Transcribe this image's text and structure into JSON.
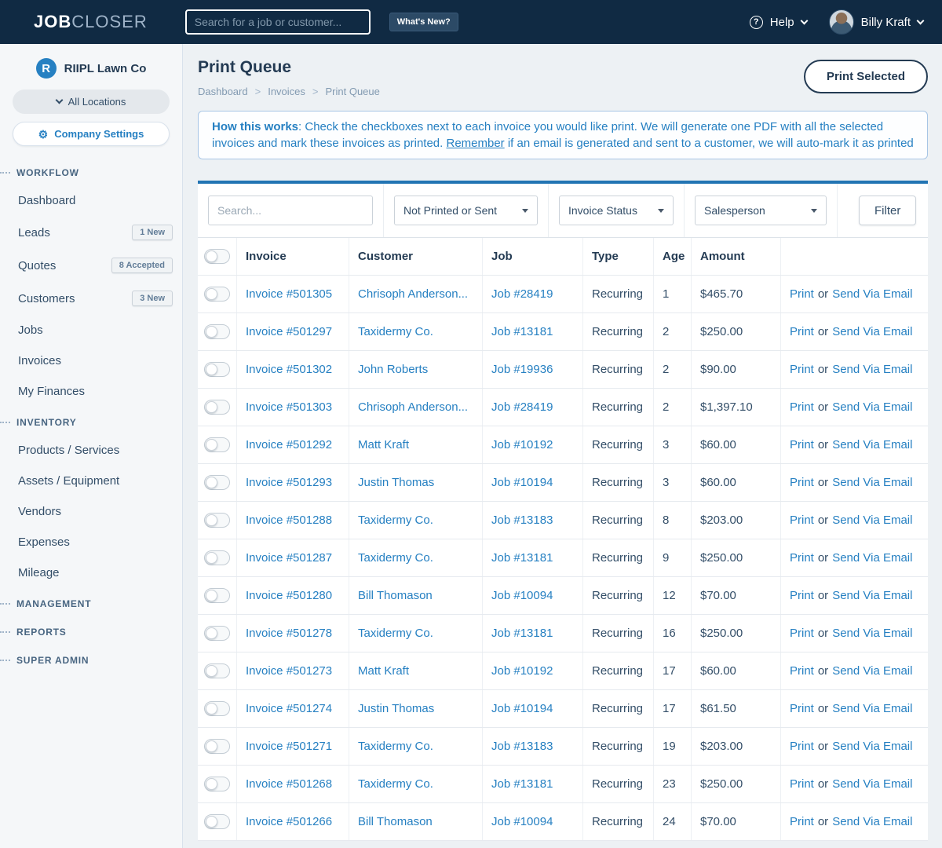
{
  "topbar": {
    "logo_bold": "JOB",
    "logo_light": "CLOSER",
    "search_placeholder": "Search for a job or customer...",
    "whats_new": "What's New?",
    "help": "Help",
    "user_name": "Billy Kraft"
  },
  "sidebar": {
    "company_initial": "R",
    "company_name": "RIIPL Lawn Co",
    "locations_label": "All Locations",
    "settings_label": "Company Settings",
    "sections": [
      {
        "label": "WORKFLOW",
        "items": [
          {
            "label": "Dashboard"
          },
          {
            "label": "Leads",
            "badge": "1 New"
          },
          {
            "label": "Quotes",
            "badge": "8 Accepted"
          },
          {
            "label": "Customers",
            "badge": "3 New"
          },
          {
            "label": "Jobs"
          },
          {
            "label": "Invoices"
          },
          {
            "label": "My Finances"
          }
        ]
      },
      {
        "label": "INVENTORY",
        "items": [
          {
            "label": "Products / Services"
          },
          {
            "label": "Assets / Equipment"
          },
          {
            "label": "Vendors"
          },
          {
            "label": "Expenses"
          },
          {
            "label": "Mileage"
          }
        ]
      },
      {
        "label": "MANAGEMENT",
        "items": []
      },
      {
        "label": "REPORTS",
        "items": []
      },
      {
        "label": "SUPER ADMIN",
        "items": []
      }
    ]
  },
  "main": {
    "title": "Print Queue",
    "breadcrumb": [
      "Dashboard",
      "Invoices",
      "Print Queue"
    ],
    "breadcrumb_separator": ">",
    "print_selected_label": "Print Selected",
    "info": {
      "lead": "How this works",
      "text1": ": Check the checkboxes next to each invoice you would like print. We will generate one PDF with all the selected invoices and mark these invoices as printed. ",
      "remember": "Remember",
      "text2": " if an email is generated and sent to a customer, we will auto-mark it as printed"
    },
    "filters": {
      "search_placeholder": "Search...",
      "printed_filter": "Not Printed or Sent",
      "status_filter": "Invoice Status",
      "salesperson_filter": "Salesperson",
      "filter_button": "Filter"
    },
    "table": {
      "headers": {
        "invoice": "Invoice",
        "customer": "Customer",
        "job": "Job",
        "type": "Type",
        "age": "Age",
        "amount": "Amount"
      },
      "action_print": "Print",
      "action_or": "or",
      "action_email": "Send Via Email",
      "rows": [
        {
          "invoice": "Invoice #501305",
          "customer": "Chrisoph Anderson...",
          "job": "Job #28419",
          "type": "Recurring",
          "age": "1",
          "amount": "$465.70"
        },
        {
          "invoice": "Invoice #501297",
          "customer": "Taxidermy Co.",
          "job": "Job #13181",
          "type": "Recurring",
          "age": "2",
          "amount": "$250.00"
        },
        {
          "invoice": "Invoice #501302",
          "customer": "John Roberts",
          "job": "Job #19936",
          "type": "Recurring",
          "age": "2",
          "amount": "$90.00"
        },
        {
          "invoice": "Invoice #501303",
          "customer": "Chrisoph Anderson...",
          "job": "Job #28419",
          "type": "Recurring",
          "age": "2",
          "amount": "$1,397.10"
        },
        {
          "invoice": "Invoice #501292",
          "customer": "Matt Kraft",
          "job": "Job #10192",
          "type": "Recurring",
          "age": "3",
          "amount": "$60.00"
        },
        {
          "invoice": "Invoice #501293",
          "customer": "Justin Thomas",
          "job": "Job #10194",
          "type": "Recurring",
          "age": "3",
          "amount": "$60.00"
        },
        {
          "invoice": "Invoice #501288",
          "customer": "Taxidermy Co.",
          "job": "Job #13183",
          "type": "Recurring",
          "age": "8",
          "amount": "$203.00"
        },
        {
          "invoice": "Invoice #501287",
          "customer": "Taxidermy Co.",
          "job": "Job #13181",
          "type": "Recurring",
          "age": "9",
          "amount": "$250.00"
        },
        {
          "invoice": "Invoice #501280",
          "customer": "Bill Thomason",
          "job": "Job #10094",
          "type": "Recurring",
          "age": "12",
          "amount": "$70.00"
        },
        {
          "invoice": "Invoice #501278",
          "customer": "Taxidermy Co.",
          "job": "Job #13181",
          "type": "Recurring",
          "age": "16",
          "amount": "$250.00"
        },
        {
          "invoice": "Invoice #501273",
          "customer": "Matt Kraft",
          "job": "Job #10192",
          "type": "Recurring",
          "age": "17",
          "amount": "$60.00"
        },
        {
          "invoice": "Invoice #501274",
          "customer": "Justin Thomas",
          "job": "Job #10194",
          "type": "Recurring",
          "age": "17",
          "amount": "$61.50"
        },
        {
          "invoice": "Invoice #501271",
          "customer": "Taxidermy Co.",
          "job": "Job #13183",
          "type": "Recurring",
          "age": "19",
          "amount": "$203.00"
        },
        {
          "invoice": "Invoice #501268",
          "customer": "Taxidermy Co.",
          "job": "Job #13181",
          "type": "Recurring",
          "age": "23",
          "amount": "$250.00"
        },
        {
          "invoice": "Invoice #501266",
          "customer": "Bill Thomason",
          "job": "Job #10094",
          "type": "Recurring",
          "age": "24",
          "amount": "$70.00"
        }
      ]
    }
  }
}
